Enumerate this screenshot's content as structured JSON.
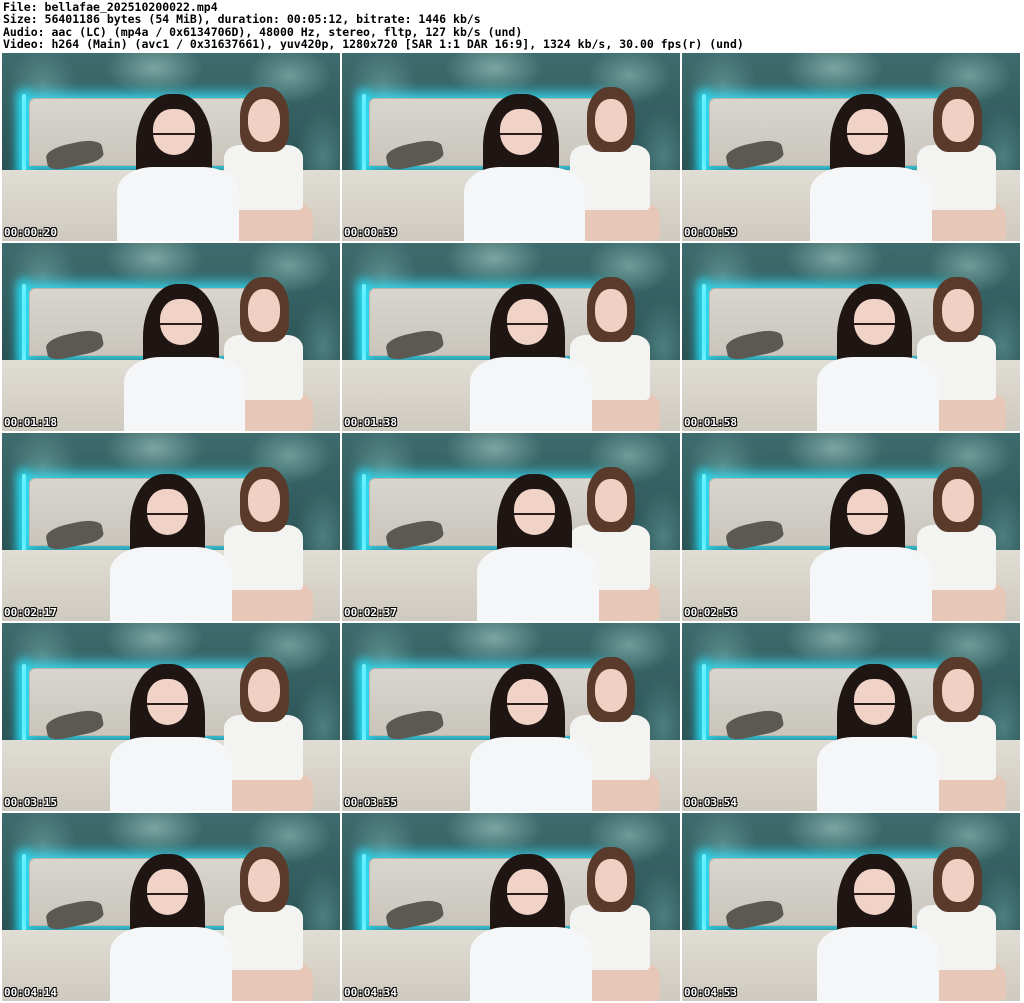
{
  "header": {
    "file_line": "File: bellafae_20251020002​2.mp4",
    "size_line": "Size: 56401186 bytes (54 MiB), duration: 00:05:12, bitrate: 1446 kb/s",
    "audio_line": "Audio: aac (LC) (mp4a / 0x6134706D), 48000 Hz, stereo, fltp, 127 kb/s (und)",
    "video_line": "Video: h264 (Main) (avc1 / 0x31637661), yuv420p, 1280x720 [SAR 1:1 DAR 16:9], 1324 kb/s, 30.00 fps(r) (und)"
  },
  "thumbnails": [
    {
      "timestamp": "00:00:20"
    },
    {
      "timestamp": "00:00:39"
    },
    {
      "timestamp": "00:00:59"
    },
    {
      "timestamp": "00:01:18"
    },
    {
      "timestamp": "00:01:38"
    },
    {
      "timestamp": "00:01:58"
    },
    {
      "timestamp": "00:02:17"
    },
    {
      "timestamp": "00:02:37"
    },
    {
      "timestamp": "00:02:56"
    },
    {
      "timestamp": "00:03:15"
    },
    {
      "timestamp": "00:03:35"
    },
    {
      "timestamp": "00:03:54"
    },
    {
      "timestamp": "00:04:14"
    },
    {
      "timestamp": "00:04:34"
    },
    {
      "timestamp": "00:04:53"
    }
  ],
  "colors": {
    "background": "#ffffff",
    "header_text": "#000000",
    "timestamp_text": "#ffffff",
    "neon_accent": "#35e6ff"
  }
}
